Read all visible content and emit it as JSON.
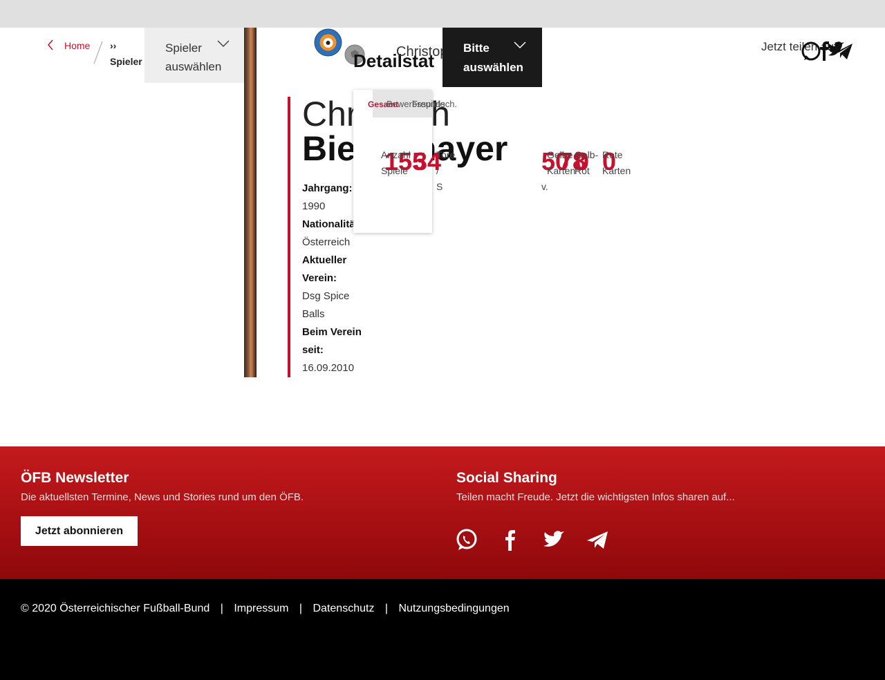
{
  "breadcrumb": {
    "home": "Home",
    "current_prefix": "››",
    "current": "Spieler"
  },
  "header": {
    "player_select_label": "Spieler auswählen",
    "section_title": "Detailstat",
    "player_name_short": "Christoph Biegelmayer",
    "choose_select_label": "Bitte auswählen",
    "share_label": "Jetzt teilen auf"
  },
  "player": {
    "first_name": "Christoph",
    "last_name": "Biegelmayer",
    "info": [
      {
        "label": "Jahrgang:",
        "value": "1990"
      },
      {
        "label": "Nationalität:",
        "value": "Österreich"
      },
      {
        "label": "Aktueller Verein:",
        "value": "Dsg Spice Balls"
      },
      {
        "label": "Beim Verein seit:",
        "value": "16.09.2010"
      }
    ]
  },
  "stats": {
    "tabs": [
      "Gesamt",
      "Bewerbsspiele",
      "Freundsch."
    ],
    "active_tab": "Gesamt",
    "values": [
      {
        "label": "Anzahl Spiele",
        "value": "155"
      },
      {
        "label": "Tore / S",
        "value": "34"
      },
      {
        "label": "Gelbe Karten",
        "value": "50"
      },
      {
        "label": "Gelb-Rot",
        "value": "0"
      },
      {
        "label": "Rote Karten",
        "value": "0"
      }
    ],
    "partial_label": "v.",
    "partial_value": "78"
  },
  "footer": {
    "newsletter_title": "ÖFB Newsletter",
    "newsletter_text": "Die aktuellsten Termine, News und Stories rund um den ÖFB.",
    "newsletter_button": "Jetzt abonnieren",
    "social_title": "Social Sharing",
    "social_text": "Teilen macht Freude. Jetzt die wichtigsten Infos sharen auf...",
    "social_icons": [
      "whatsapp-icon",
      "facebook-icon",
      "twitter-icon",
      "telegram-icon"
    ],
    "copyright": "© 2020 Österreichischer Fußball-Bund",
    "links": [
      "Impressum",
      "Datenschutz",
      "Nutzungsbedingungen"
    ],
    "separator": "|"
  },
  "colors": {
    "accent": "#c8102e",
    "footer_red": "#a50f12",
    "footer_black": "#000000"
  }
}
